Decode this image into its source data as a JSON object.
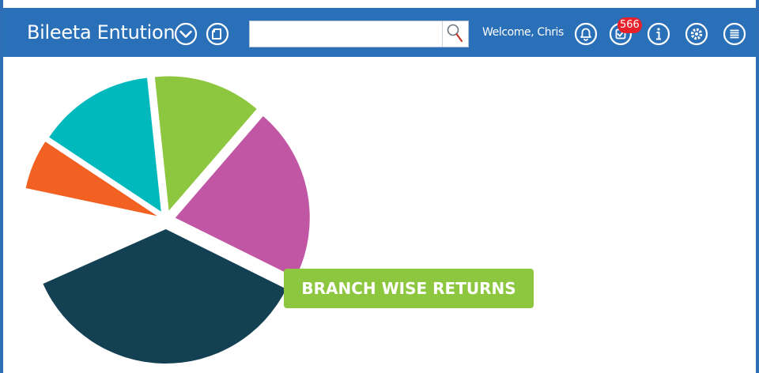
{
  "header": {
    "title": "Bileeta Entution",
    "welcome": "Welcome, Chris",
    "notification_count": "566",
    "search": {
      "value": "",
      "placeholder": ""
    },
    "icons": [
      "chevron-down-icon",
      "document-icon",
      "search-icon",
      "bell-icon",
      "tasks-check-icon",
      "info-icon",
      "gear-icon",
      "menu-icon"
    ]
  },
  "colors": {
    "header_bg": "#2a70b8",
    "badge": "#e8212b",
    "label_bg": "#8dc63f"
  },
  "chart_data": {
    "type": "pie",
    "title": "BRANCH WISE RETURNS",
    "exploded": true,
    "slices": [
      {
        "share": 0.06,
        "color": "#f26122"
      },
      {
        "share": 0.14,
        "color": "#00b9bd"
      },
      {
        "share": 0.13,
        "color": "#8dc63f"
      },
      {
        "share": 0.21,
        "color": "#c056a4"
      },
      {
        "share": 0.36,
        "color": "#134052"
      }
    ]
  }
}
